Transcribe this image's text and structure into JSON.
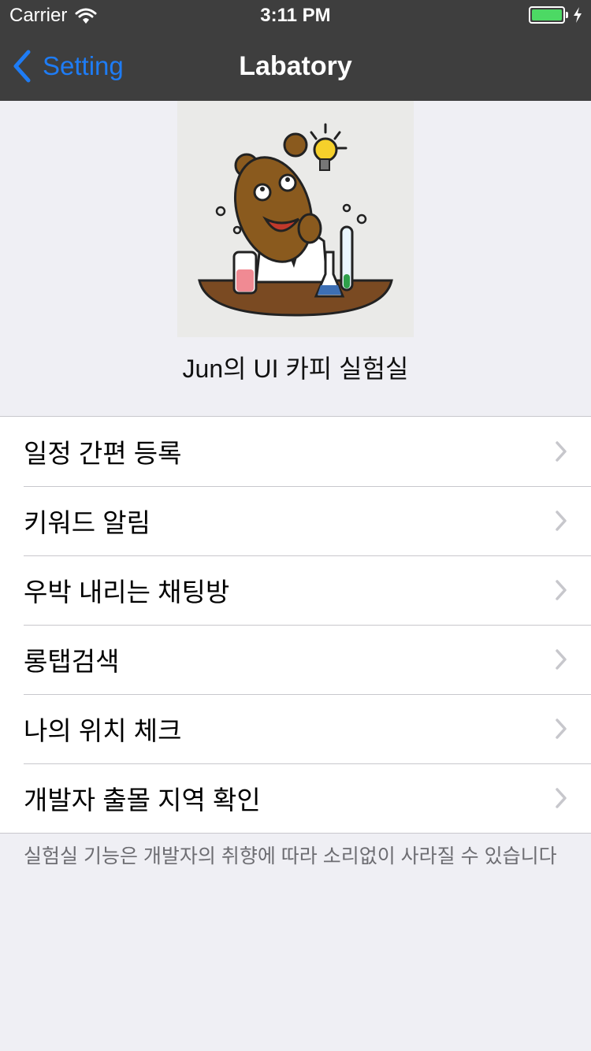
{
  "status_bar": {
    "carrier": "Carrier",
    "time": "3:11 PM",
    "battery_level": 1.0,
    "icons": [
      "wifi-icon",
      "battery-icon",
      "charging-bolt-icon"
    ]
  },
  "nav": {
    "back_label": "Setting",
    "title": "Labatory"
  },
  "header": {
    "title": "Jun의 UI 카피 실험실",
    "image": "scientist-bear-illustration"
  },
  "menu": {
    "items": [
      {
        "label": "일정 간편 등록"
      },
      {
        "label": "키워드 알림"
      },
      {
        "label": "우박 내리는 채팅방"
      },
      {
        "label": "롱탭검색"
      },
      {
        "label": "나의 위치 체크"
      },
      {
        "label": "개발자 출몰 지역 확인"
      }
    ]
  },
  "footer": {
    "note": "실험실 기능은 개발자의 취향에 따라 소리없이 사라질 수 있습니다"
  },
  "colors": {
    "bar_background": "#3e3e3e",
    "accent": "#1e7cf5",
    "battery": "#4cd964",
    "page_background": "#efeff4"
  }
}
